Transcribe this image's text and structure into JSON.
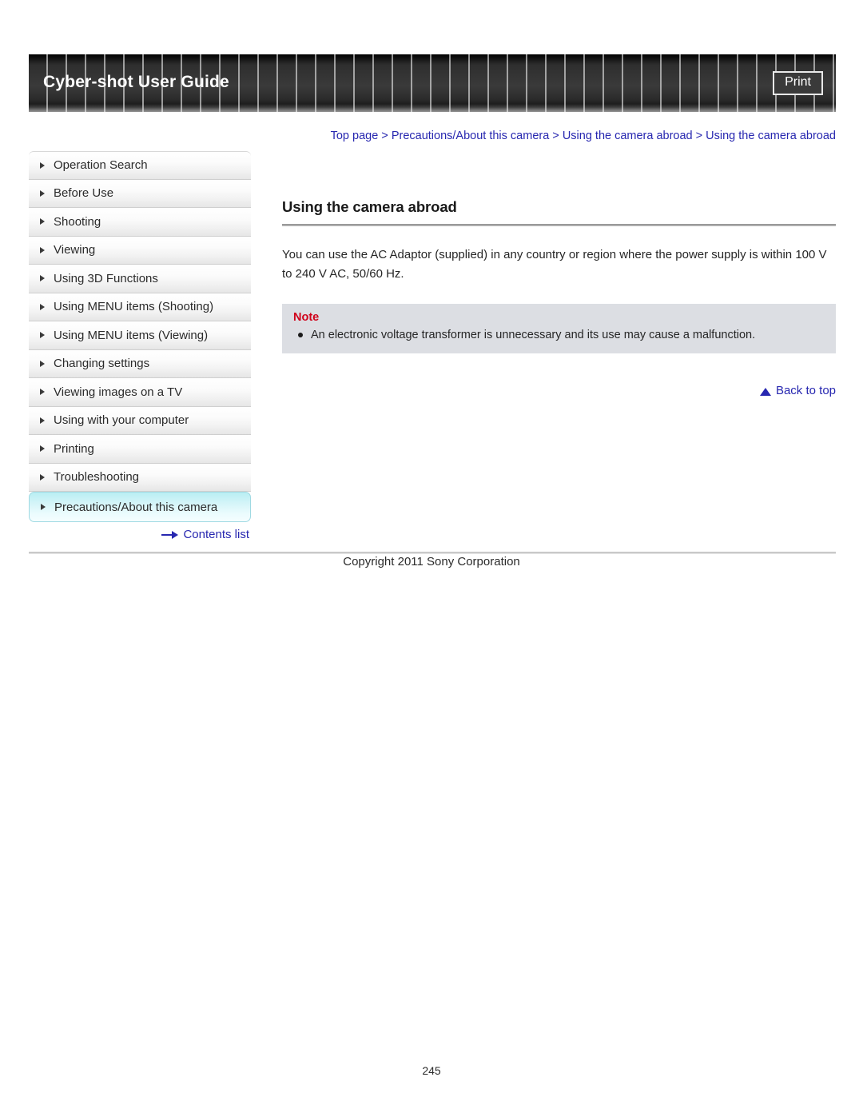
{
  "header": {
    "site_title": "Cyber-shot User Guide",
    "print_label": "Print"
  },
  "breadcrumb": {
    "separator": " > ",
    "items": [
      "Top page",
      "Precautions/About this camera",
      "Using the camera abroad",
      "Using the camera abroad"
    ]
  },
  "sidebar": {
    "items": [
      {
        "label": "Operation Search",
        "selected": false
      },
      {
        "label": "Before Use",
        "selected": false
      },
      {
        "label": "Shooting",
        "selected": false
      },
      {
        "label": "Viewing",
        "selected": false
      },
      {
        "label": "Using 3D Functions",
        "selected": false
      },
      {
        "label": "Using MENU items (Shooting)",
        "selected": false
      },
      {
        "label": "Using MENU items (Viewing)",
        "selected": false
      },
      {
        "label": "Changing settings",
        "selected": false
      },
      {
        "label": "Viewing images on a TV",
        "selected": false
      },
      {
        "label": "Using with your computer",
        "selected": false
      },
      {
        "label": "Printing",
        "selected": false
      },
      {
        "label": "Troubleshooting",
        "selected": false
      },
      {
        "label": "Precautions/About this camera",
        "selected": true
      }
    ],
    "contents_list_label": "Contents list"
  },
  "main": {
    "heading": "Using the camera abroad",
    "intro": "You can use the AC Adaptor (supplied) in any country or region where the power supply is within 100 V to 240 V AC, 50/60 Hz.",
    "note": {
      "title": "Note",
      "items": [
        "An electronic voltage transformer is unnecessary and its use may cause a malfunction."
      ]
    },
    "back_to_top_label": "Back to top"
  },
  "footer": {
    "copyright": "Copyright 2011 Sony Corporation",
    "page_number": "245"
  },
  "colors": {
    "link": "#2727b0",
    "note_title": "#d0021b",
    "note_background": "#dcdee3",
    "selected_nav": "#b9eef3"
  }
}
